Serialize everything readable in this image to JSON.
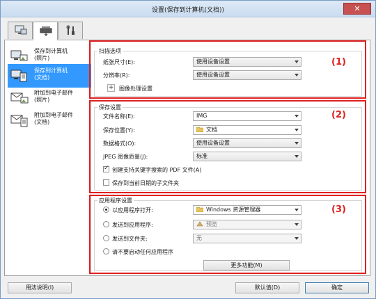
{
  "window": {
    "title": "设置(保存到计算机(文档))",
    "close_glyph": "✕"
  },
  "tabs": [
    {
      "name": "scan-from-computer-tab-icon"
    },
    {
      "name": "scanner-operation-panel-tab-icon"
    },
    {
      "name": "general-settings-tab-icon"
    }
  ],
  "sidebar": {
    "items": [
      {
        "label_line1": "保存到计算机",
        "label_line2": "(照片)",
        "selected": false
      },
      {
        "label_line1": "保存到计算机",
        "label_line2": "(文档)",
        "selected": true
      },
      {
        "label_line1": "附加到电子邮件",
        "label_line2": "(照片)",
        "selected": false
      },
      {
        "label_line1": "附加到电子邮件",
        "label_line2": "(文档)",
        "selected": false
      }
    ]
  },
  "callouts": [
    "(1)",
    "(2)",
    "(3)"
  ],
  "scan_options": {
    "title": "扫描选项",
    "paper_size_label": "纸张尺寸(E):",
    "paper_size_value": "使用设备设置",
    "resolution_label": "分辨率(R):",
    "resolution_value": "使用设备设置",
    "image_processing_plus": "+",
    "image_processing_label": "图像处理设置"
  },
  "save_settings": {
    "title": "保存设置",
    "file_name_label": "文件名称(E):",
    "file_name_value": "IMG",
    "save_in_label": "保存位置(Y):",
    "save_in_value": "文档",
    "data_format_label": "数据格式(O):",
    "data_format_value": "使用设备设置",
    "jpeg_quality_label": "JPEG 图像质量(J):",
    "jpeg_quality_value": "标准",
    "searchable_pdf_label": "创建支持关键字搜索的 PDF 文件(A)",
    "searchable_pdf_checked": true,
    "subfolder_label": "保存到当前日期的子文件夹",
    "subfolder_checked": false
  },
  "app_settings": {
    "title": "应用程序设置",
    "open_with_label": "以应用程序打开:",
    "open_with_value": "Windows 资源管理器",
    "send_to_app_label": "发送到应用程序:",
    "send_to_app_value": "预览",
    "send_to_folder_label": "发送到文件夹:",
    "send_to_folder_value": "无",
    "no_app_label": "请不要启动任何应用程序",
    "more_functions_label": "更多功能(M)",
    "selected_option": "open_with"
  },
  "footer": {
    "instructions_label": "用法说明(I)",
    "defaults_label": "默认值(D)",
    "ok_label": "确定"
  }
}
